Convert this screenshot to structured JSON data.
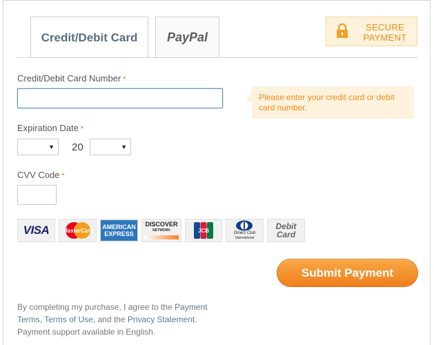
{
  "tabs": {
    "card_label": "Credit/Debit Card",
    "paypal_label": "PayPal"
  },
  "secure_badge": {
    "line1": "SECURE",
    "line2": "PAYMENT"
  },
  "form": {
    "card_number_label": "Credit/Debit Card Number",
    "card_number_value": "",
    "card_tooltip": "Please enter your credit card or debit card number.",
    "expiration_label": "Expiration Date",
    "month_value": "",
    "year_prefix": "20",
    "year_value": "",
    "cvv_label": "CVV Code",
    "cvv_value": "",
    "required_mark": "*"
  },
  "card_logos": {
    "visa": "VISA",
    "mastercard": "MasterCard",
    "amex_line1": "AMERICAN",
    "amex_line2": "EXPRESS",
    "discover": "DISCOVER",
    "discover_sub": "NETWORK",
    "jcb": "JCB",
    "diners_line1": "Diners Club",
    "diners_line2": "International",
    "debit_line1": "Debit",
    "debit_line2": "Card"
  },
  "submit_label": "Submit Payment",
  "legal": {
    "prefix": "By completing my purchase, I agree to the ",
    "payment_terms": "Payment Terms",
    "sep1": ", ",
    "terms_of_use": "Terms of Use",
    "sep2": ", and the ",
    "privacy": "Privacy Statement",
    "suffix": ".",
    "support": "Payment support available in English."
  },
  "colors": {
    "accent_orange": "#f08b1d",
    "tab_text": "#5a6f82",
    "link": "#5a7a98"
  }
}
